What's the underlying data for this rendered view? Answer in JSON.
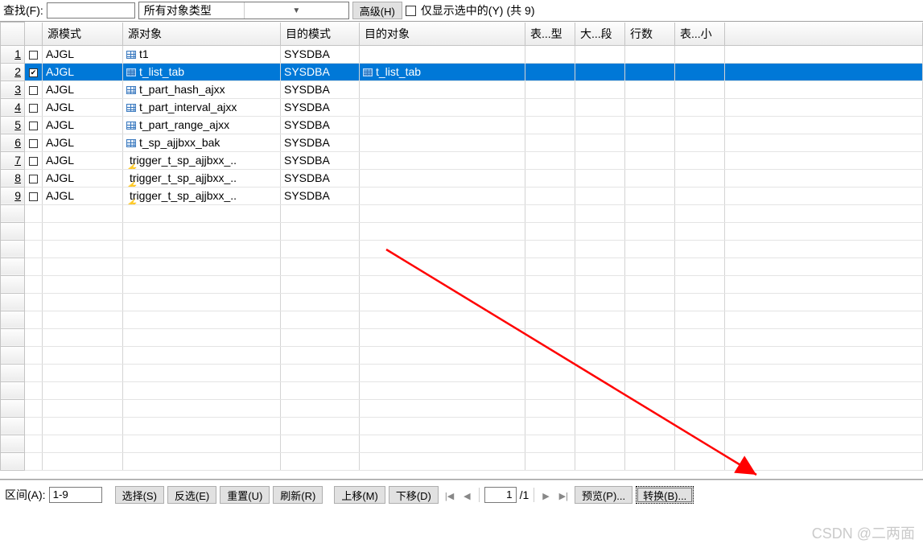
{
  "topbar": {
    "search_label": "查找(F):",
    "search_value": "",
    "type_combo": "所有对象类型",
    "advanced_btn": "高级(H)",
    "only_selected_label": "仅显示选中的(Y)",
    "count_label": "(共 9)"
  },
  "columns": {
    "src_mode": "源模式",
    "src_obj": "源对象",
    "dst_mode": "目的模式",
    "dst_obj": "目的对象",
    "tbl_type": "表...型",
    "big_seg": "大...段",
    "rows": "行数",
    "tbl_small": "表...小"
  },
  "rows": [
    {
      "n": "1",
      "chk": false,
      "icon": "table",
      "src_mode": "AJGL",
      "src_obj": "t1",
      "dst_mode": "SYSDBA",
      "dst_obj": "",
      "sel": false
    },
    {
      "n": "2",
      "chk": true,
      "icon": "table",
      "src_mode": "AJGL",
      "src_obj": "t_list_tab",
      "dst_mode": "SYSDBA",
      "dst_obj": "t_list_tab",
      "dst_icon": "table",
      "sel": true
    },
    {
      "n": "3",
      "chk": false,
      "icon": "table",
      "src_mode": "AJGL",
      "src_obj": "t_part_hash_ajxx",
      "dst_mode": "SYSDBA",
      "dst_obj": "",
      "sel": false
    },
    {
      "n": "4",
      "chk": false,
      "icon": "table",
      "src_mode": "AJGL",
      "src_obj": "t_part_interval_ajxx",
      "dst_mode": "SYSDBA",
      "dst_obj": "",
      "sel": false
    },
    {
      "n": "5",
      "chk": false,
      "icon": "table",
      "src_mode": "AJGL",
      "src_obj": "t_part_range_ajxx",
      "dst_mode": "SYSDBA",
      "dst_obj": "",
      "sel": false
    },
    {
      "n": "6",
      "chk": false,
      "icon": "table",
      "src_mode": "AJGL",
      "src_obj": "t_sp_ajjbxx_bak",
      "dst_mode": "SYSDBA",
      "dst_obj": "",
      "sel": false
    },
    {
      "n": "7",
      "chk": false,
      "icon": "trigger",
      "src_mode": "AJGL",
      "src_obj": "trigger_t_sp_ajjbxx_..",
      "dst_mode": "SYSDBA",
      "dst_obj": "",
      "sel": false
    },
    {
      "n": "8",
      "chk": false,
      "icon": "trigger",
      "src_mode": "AJGL",
      "src_obj": "trigger_t_sp_ajjbxx_..",
      "dst_mode": "SYSDBA",
      "dst_obj": "",
      "sel": false
    },
    {
      "n": "9",
      "chk": false,
      "icon": "trigger",
      "src_mode": "AJGL",
      "src_obj": "trigger_t_sp_ajjbxx_..",
      "dst_mode": "SYSDBA",
      "dst_obj": "",
      "sel": false
    }
  ],
  "bottom": {
    "range_label": "区间(A):",
    "range_value": "1-9",
    "select_btn": "选择(S)",
    "invert_btn": "反选(E)",
    "reset_btn": "重置(U)",
    "refresh_btn": "刷新(R)",
    "moveup_btn": "上移(M)",
    "movedown_btn": "下移(D)",
    "page_cur": "1",
    "page_total": "/1",
    "preview_btn": "预览(P)...",
    "convert_btn": "转换(B)..."
  },
  "watermark": "CSDN @二两面"
}
